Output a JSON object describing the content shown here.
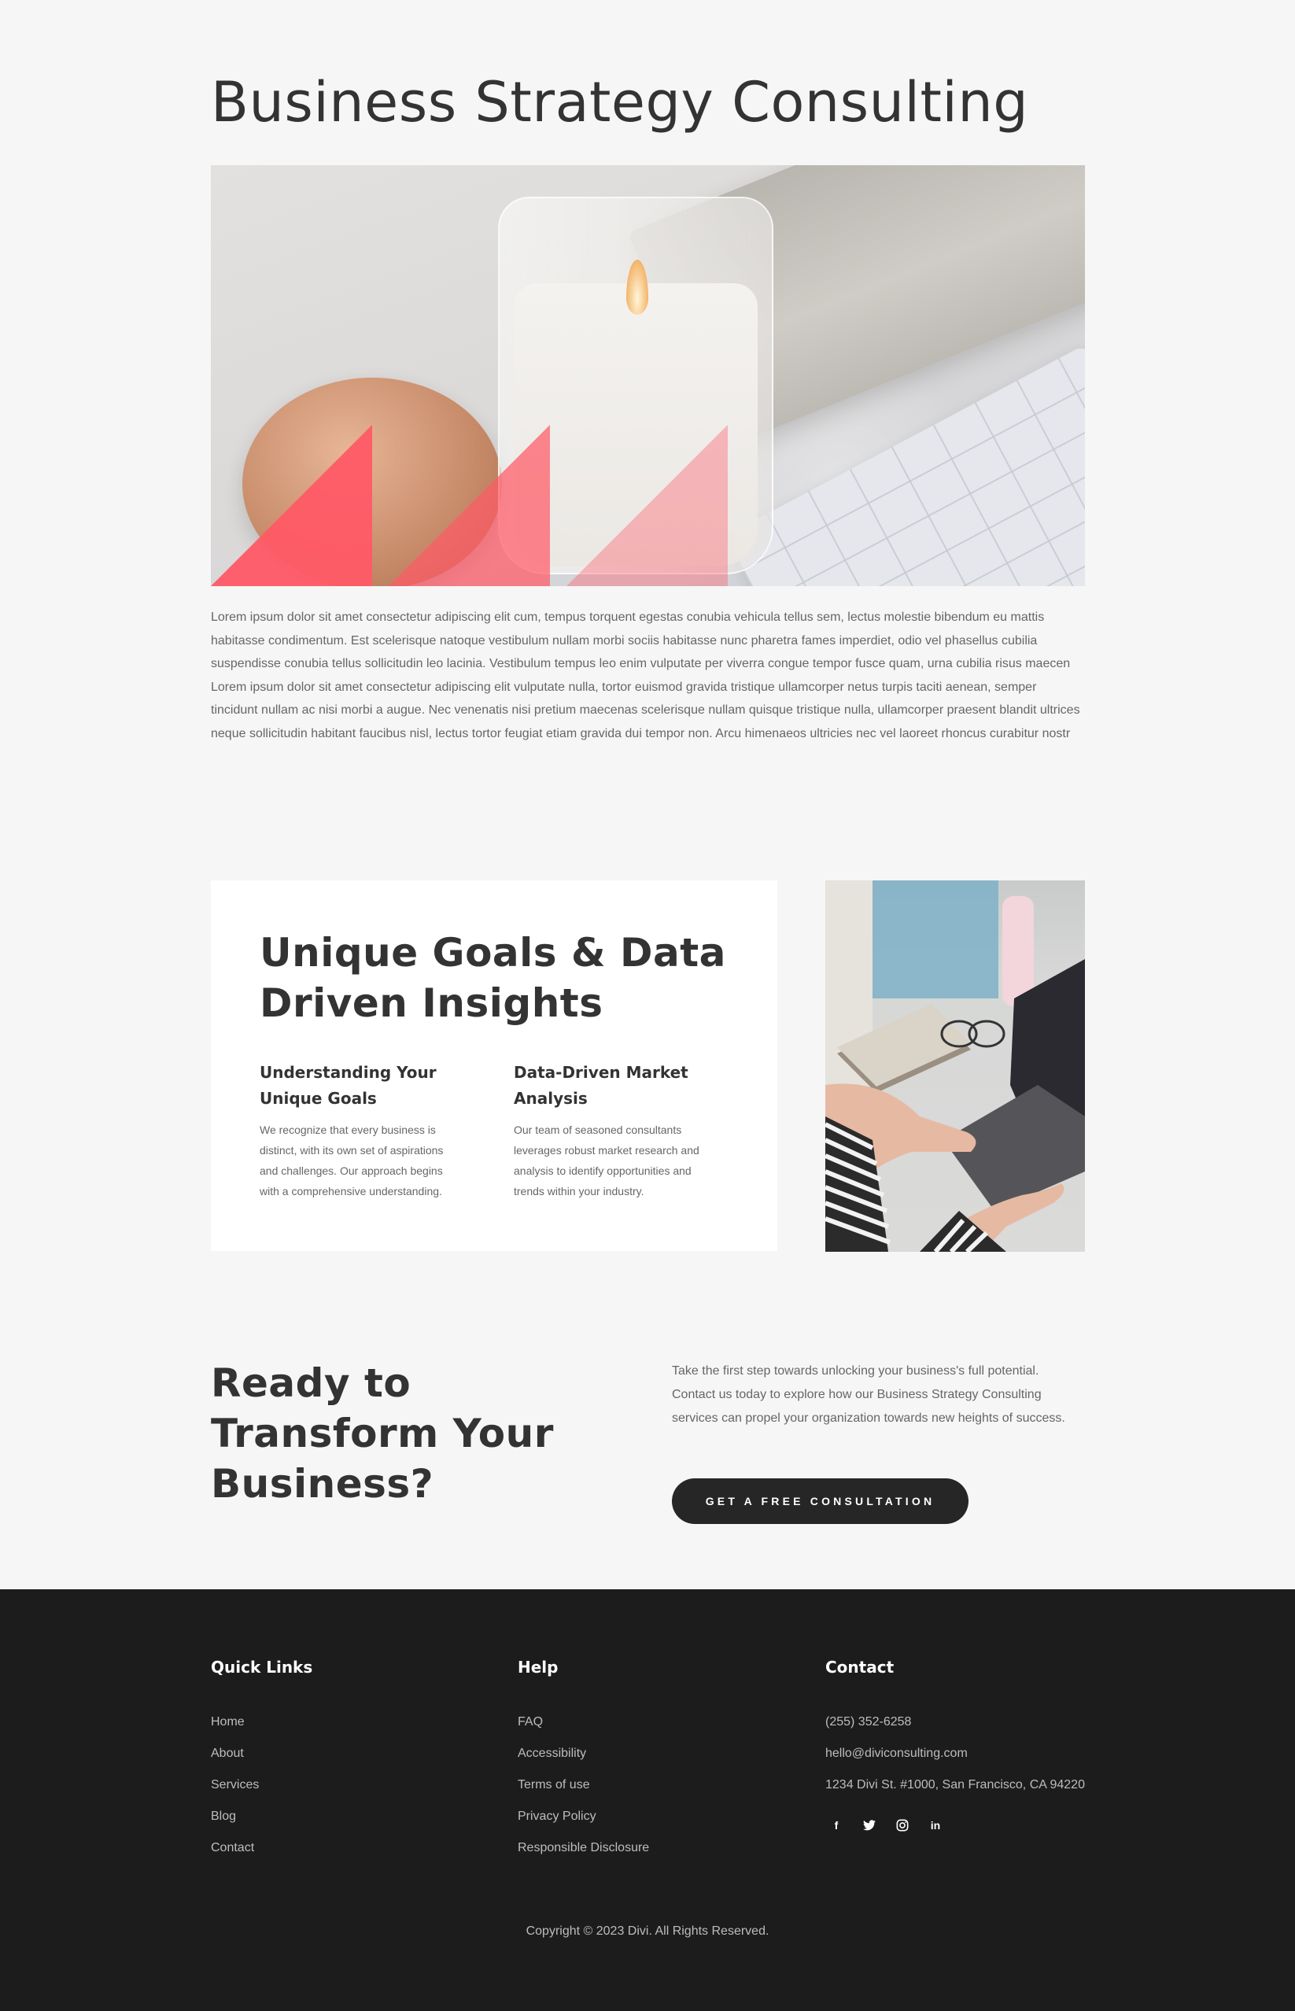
{
  "hero": {
    "title": "Business Strategy Consulting",
    "image_description": "candle",
    "accent_color": "#ff5a66"
  },
  "intro": {
    "text": "Lorem ipsum dolor sit amet consectetur adipiscing elit cum, tempus torquent egestas conubia vehicula tellus sem, lectus molestie bibendum eu mattis habitasse condimentum. Est scelerisque natoque vestibulum nullam morbi sociis habitasse nunc pharetra fames imperdiet, odio vel phasellus cubilia suspendisse conubia tellus sollicitudin leo lacinia. Vestibulum tempus leo enim vulputate per viverra congue tempor fusce quam, urna cubilia risus maecen Lorem ipsum dolor sit amet consectetur adipiscing elit vulputate nulla, tortor euismod gravida tristique ullamcorper netus turpis taciti aenean, semper tincidunt nullam ac nisi morbi a augue. Nec venenatis nisi pretium maecenas scelerisque nullam quisque tristique nulla, ullamcorper praesent blandit ultrices neque sollicitudin habitant faucibus nisl, lectus tortor feugiat etiam gravida dui tempor non. Arcu himenaeos ultricies nec vel laoreet rhoncus curabitur nostr"
  },
  "goals": {
    "title": "Unique Goals & Data Driven Insights",
    "features": [
      {
        "title": "Understanding Your Unique Goals",
        "text": "We recognize that every business is distinct, with its own set of aspirations and challenges. Our approach begins with a comprehensive understanding."
      },
      {
        "title": "Data-Driven Market Analysis",
        "text": "Our team of seasoned consultants leverages robust market research and analysis to identify opportunities and trends within your industry."
      }
    ]
  },
  "cta": {
    "title": "Ready to Transform Your Business?",
    "text": "Take the first step towards unlocking your business's full potential. Contact us today to explore how our Business Strategy Consulting services can propel your organization towards new heights of success.",
    "button_label": "GET A FREE CONSULTATION"
  },
  "footer": {
    "quick_links": {
      "heading": "Quick Links",
      "items": [
        "Home",
        "About",
        "Services",
        "Blog",
        "Contact"
      ]
    },
    "help": {
      "heading": "Help",
      "items": [
        "FAQ",
        "Accessibility",
        "Terms of use",
        "Privacy Policy",
        "Responsible Disclosure"
      ]
    },
    "contact": {
      "heading": "Contact",
      "phone": "(255) 352-6258",
      "email": "hello@diviconsulting.com",
      "address": "1234 Divi St. #1000, San Francisco, CA 94220"
    },
    "socials": [
      {
        "icon": "facebook-icon",
        "glyph": "f"
      },
      {
        "icon": "twitter-icon",
        "glyph": "t"
      },
      {
        "icon": "instagram-icon",
        "glyph": "◎"
      },
      {
        "icon": "linkedin-icon",
        "glyph": "in"
      }
    ],
    "copyright": "Copyright © 2023 Divi. All Rights Reserved."
  },
  "colors": {
    "background": "#f6f6f6",
    "text": "#333333",
    "footer": "#1c1c1c",
    "button": "#262626",
    "accent": "#ff5a66"
  }
}
